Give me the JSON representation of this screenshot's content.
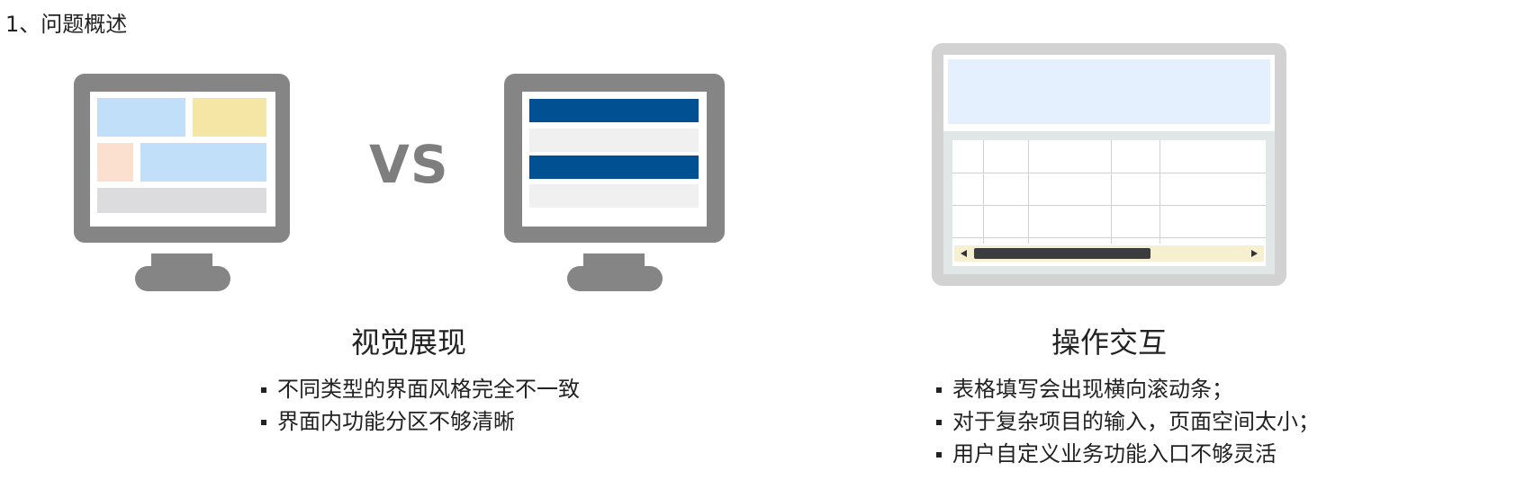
{
  "heading": "1、问题概述",
  "vs_label": "VS",
  "left_section": {
    "title": "视觉展现",
    "bullets": [
      "不同类型的界面风格完全不一致",
      "界面内功能分区不够清晰"
    ]
  },
  "right_section": {
    "title": "操作交互",
    "bullets": [
      "表格填写会出现横向滚动条；",
      "对于复杂项目的输入，页面空间太小；",
      "用户自定义业务功能入口不够灵活"
    ]
  },
  "colors": {
    "monitor_frame": "#858585",
    "light_blue": "#c2dffa",
    "light_yellow": "#f5e6a6",
    "light_peach": "#fce0cf",
    "light_gray": "#dcdcdf",
    "dark_blue": "#005092",
    "row_gray": "#f0f0f0",
    "tablet_frame": "#d2d2d2",
    "scroll_thumb": "#3a3c3f",
    "scroll_track": "#f7f0d0"
  }
}
